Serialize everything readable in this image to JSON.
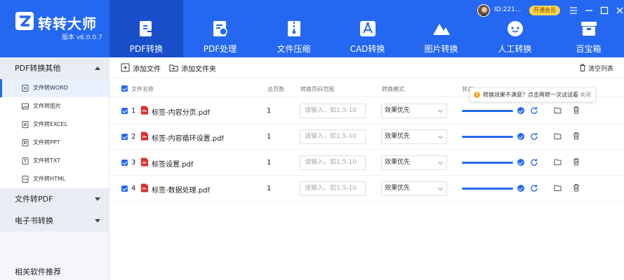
{
  "app": {
    "name": "转转大师",
    "version": "版本 v6.0.0.7"
  },
  "user": {
    "id": "ID:221...",
    "vip_label": "开通会员"
  },
  "nav": [
    {
      "label": "PDF转换",
      "icon": "pdf-convert-icon"
    },
    {
      "label": "PDF处理",
      "icon": "pdf-process-icon"
    },
    {
      "label": "文件压缩",
      "icon": "compress-icon"
    },
    {
      "label": "CAD转换",
      "icon": "cad-icon"
    },
    {
      "label": "图片转换",
      "icon": "image-convert-icon"
    },
    {
      "label": "人工转换",
      "icon": "manual-service-icon"
    },
    {
      "label": "百宝箱",
      "icon": "toolbox-icon"
    }
  ],
  "sidebar": {
    "group1": "PDF转换其他",
    "items": [
      "文件转WORD",
      "文件转图片",
      "文件转EXCEL",
      "文件转PPT",
      "文件转TXT",
      "文件转HTML"
    ],
    "group2": "文件转PDF",
    "group3": "电子书转换",
    "footer": "相关软件推荐"
  },
  "toolbar": {
    "add_file": "添加文件",
    "add_folder": "添加文件夹",
    "clear_list": "清空列表"
  },
  "table": {
    "headers": {
      "name": "文件名称",
      "pages": "总页数",
      "range": "转换页码范围",
      "mode": "转换模式",
      "status": "状态"
    },
    "range_placeholder": "请输入，如1,5-10",
    "rows": [
      {
        "num": "1",
        "name": "标签-内容分页.pdf",
        "pages": "1",
        "mode": "效果优先",
        "progress": 1.0
      },
      {
        "num": "2",
        "name": "标签-内容循环设置.pdf",
        "pages": "1",
        "mode": "效果优先",
        "progress": 1.0
      },
      {
        "num": "3",
        "name": "标签设置.pdf",
        "pages": "1",
        "mode": "效果优先",
        "progress": 1.0
      },
      {
        "num": "4",
        "name": "标签-数据处理.pdf",
        "pages": "1",
        "mode": "效果优先",
        "progress": 1.0
      }
    ]
  },
  "tooltip": {
    "text": "转换效果不满意？点击再转一次试试看",
    "close": "关闭"
  },
  "colors": {
    "primary": "#2468f2",
    "nav_active": "#1a4fcc",
    "pdf_red": "#e02d2d",
    "vip_gold": "#fcd34d"
  }
}
